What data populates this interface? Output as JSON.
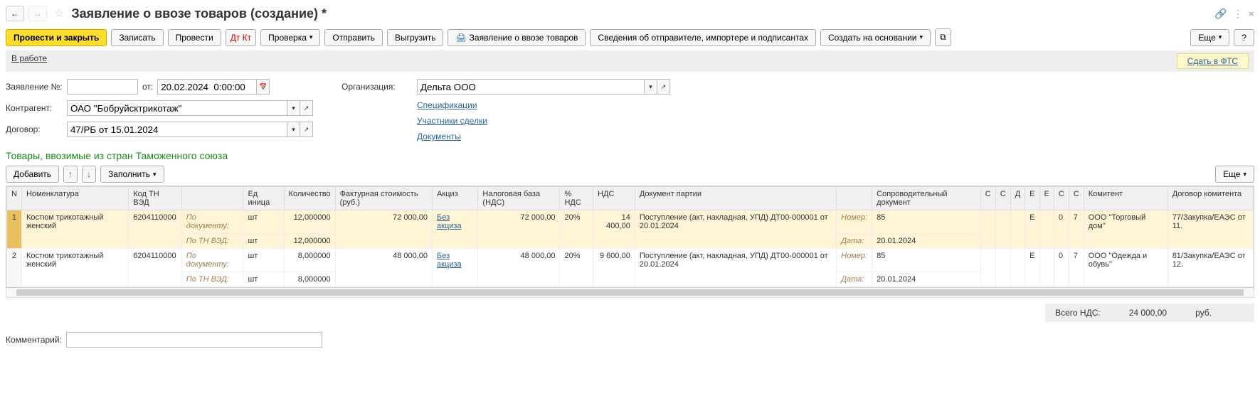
{
  "header": {
    "title": "Заявление о ввозе товаров (создание) *"
  },
  "toolbar": {
    "post_close": "Провести и закрыть",
    "save": "Записать",
    "post": "Провести",
    "dtk": "Дт Кт",
    "check": "Проверка",
    "send": "Отправить",
    "upload": "Выгрузить",
    "print": "Заявление о ввозе товаров",
    "sender": "Сведения об отправителе, импортере и подписантах",
    "create_on": "Создать на основании",
    "more": "Еще",
    "help": "?"
  },
  "status": {
    "text": "В работе",
    "fts": "Сдать в ФТС"
  },
  "form": {
    "num_lbl": "Заявление №:",
    "num": "",
    "from_lbl": "от:",
    "date": "20.02.2024  0:00:00",
    "org_lbl": "Организация:",
    "org": "Дельта ООО",
    "cp_lbl": "Контрагент:",
    "cp": "ОАО \"Бобруйсктрикотаж\"",
    "contract_lbl": "Договор:",
    "contract": "47/РБ от 15.01.2024",
    "links": {
      "spec": "Спецификации",
      "parties": "Участники сделки",
      "docs": "Документы"
    }
  },
  "section": "Товары, ввозимые из стран Таможенного союза",
  "table_toolbar": {
    "add": "Добавить",
    "fill": "Заполнить",
    "more": "Еще"
  },
  "cols": {
    "n": "N",
    "nom": "Номенклатура",
    "tnved": "Код ТН ВЭД",
    "sub": "",
    "unit": "Ед иница",
    "qty": "Количество",
    "inv": "Фактурная стоимость (руб.)",
    "excise": "Акциз",
    "base": "Налоговая база (НДС)",
    "rate": "% НДС",
    "vat": "НДС",
    "batch": "Документ партии",
    "accomp_lbl": "",
    "accomp": "Сопроводительный документ",
    "c1": "С",
    "c2": "С",
    "c3": "Д",
    "c4": "Е",
    "c5": "Е",
    "c6": "С",
    "c7": "С",
    "komitent": "Комитент",
    "kcontract": "Договор комитента"
  },
  "subrows": {
    "doc": "По документу:",
    "tnved": "По ТН ВЭД:",
    "num": "Номер:",
    "date": "Дата:"
  },
  "rows": [
    {
      "n": "1",
      "nom": "Костюм трикотажный женский",
      "tnved": "6204110000",
      "unit": "шт",
      "qty1": "12,000000",
      "qty2": "12,000000",
      "inv": "72 000,00",
      "excise": "Без акциза",
      "base": "72 000,00",
      "rate": "20%",
      "vat": "14 400,00",
      "batch": "Поступление (акт, накладная, УПД) ДТ00-000001 от 20.01.2024",
      "anum": "85",
      "adate": "20.01.2024",
      "c4": "Е",
      "c6": "0",
      "c7": "7",
      "komitent": "ООО \"Торговый дом\"",
      "kcontract": "77/Закупка/ЕАЭС от 11.",
      "selected": true
    },
    {
      "n": "2",
      "nom": "Костюм трикотажный женский",
      "tnved": "6204110000",
      "unit": "шт",
      "qty1": "8,000000",
      "qty2": "8,000000",
      "inv": "48 000,00",
      "excise": "Без акциза",
      "base": "48 000,00",
      "rate": "20%",
      "vat": "9 600,00",
      "batch": "Поступление (акт, накладная, УПД) ДТ00-000001 от 20.01.2024",
      "anum": "85",
      "adate": "20.01.2024",
      "c4": "Е",
      "c6": "0",
      "c7": "7",
      "komitent": "ООО \"Одежда и обувь\"",
      "kcontract": "81/Закупка/ЕАЭС от 12.",
      "selected": false
    }
  ],
  "total": {
    "lbl": "Всего НДС:",
    "val": "24 000,00",
    "cur": "руб."
  },
  "comment_lbl": "Комментарий:"
}
